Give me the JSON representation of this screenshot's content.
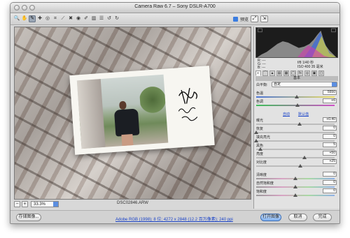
{
  "window": {
    "title": "Camera Raw 6.7  –  Sony DSLR-A700"
  },
  "toolbar": {
    "tools": [
      {
        "name": "zoom-icon",
        "glyph": "🔍"
      },
      {
        "name": "hand-icon",
        "glyph": "✋"
      },
      {
        "name": "white-balance-icon",
        "glyph": "✎"
      },
      {
        "name": "color-sampler-icon",
        "glyph": "✚"
      },
      {
        "name": "targeted-adjust-icon",
        "glyph": "◎"
      },
      {
        "name": "crop-icon",
        "glyph": "⌗"
      },
      {
        "name": "straighten-icon",
        "glyph": "⟋"
      },
      {
        "name": "spot-removal-icon",
        "glyph": "✖"
      },
      {
        "name": "red-eye-icon",
        "glyph": "◉"
      },
      {
        "name": "adjustment-brush-icon",
        "glyph": "✐"
      },
      {
        "name": "graduated-filter-icon",
        "glyph": "▥"
      },
      {
        "name": "preferences-icon",
        "glyph": "☰"
      },
      {
        "name": "rotate-left-icon",
        "glyph": "↺"
      },
      {
        "name": "rotate-right-icon",
        "glyph": "↻"
      }
    ],
    "preview_label": "预览"
  },
  "zoom": {
    "value": "33.3%"
  },
  "filename": "DSC02846.ARW",
  "workflow_link": "Adobe RGB (1998); 8 位; 4272 x 2848 (12.2 百万像素); 240 ppi",
  "buttons": {
    "save": "存储图像...",
    "open": "打开图像",
    "cancel": "取消",
    "done": "完成"
  },
  "info": {
    "r": "R: ---",
    "g": "G: ---",
    "b": "B: ---",
    "aperture": "f/8   1/40 秒",
    "iso": "ISO 400   35 毫米"
  },
  "panel": {
    "header": "基本",
    "white_balance_label": "白平衡:",
    "white_balance_value": "自定",
    "auto_link": "自动",
    "default_link": "默认值"
  },
  "sliders": [
    {
      "label": "色温",
      "value": "5550",
      "pos": 0.52
    },
    {
      "label": "色调",
      "value": "+6",
      "pos": 0.53
    },
    {
      "label": "曝光",
      "value": "+0.40",
      "pos": 0.55
    },
    {
      "label": "恢复",
      "value": "0",
      "pos": 0.0
    },
    {
      "label": "填充亮光",
      "value": "0",
      "pos": 0.0
    },
    {
      "label": "黑色",
      "value": "5",
      "pos": 0.05
    },
    {
      "label": "亮度",
      "value": "+50",
      "pos": 0.62
    },
    {
      "label": "对比度",
      "value": "+25",
      "pos": 0.56
    },
    {
      "label": "清晰度",
      "value": "0",
      "pos": 0.5
    },
    {
      "label": "自然饱和度",
      "value": "0",
      "pos": 0.5
    },
    {
      "label": "饱和度",
      "value": "0",
      "pos": 0.5
    }
  ],
  "colors": {
    "accent": "#3b7de0",
    "link": "#1a43c8"
  }
}
